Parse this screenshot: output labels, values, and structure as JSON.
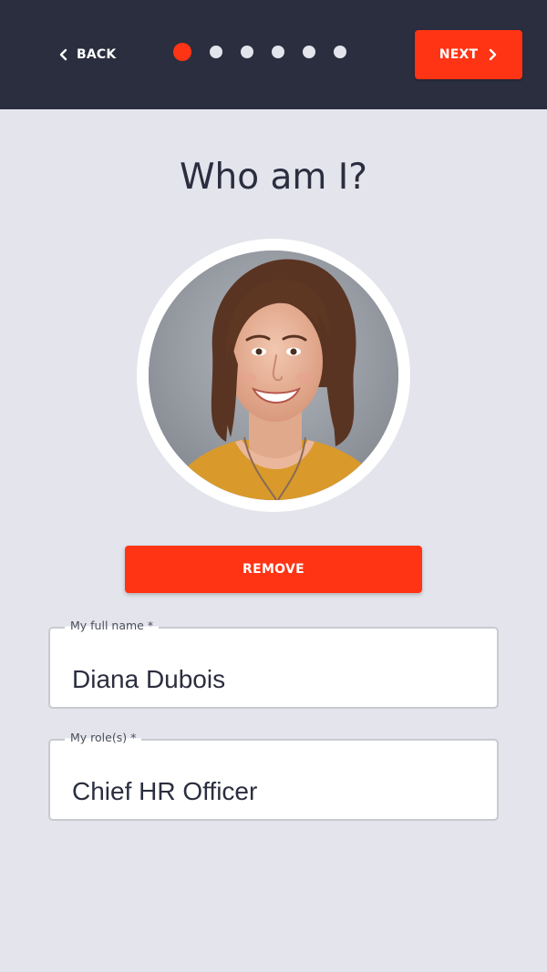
{
  "header": {
    "back_label": "BACK",
    "next_label": "NEXT",
    "steps": {
      "total": 6,
      "current": 1
    }
  },
  "page": {
    "title": "Who am I?"
  },
  "avatar": {
    "icon": "profile-photo"
  },
  "actions": {
    "remove_label": "REMOVE"
  },
  "form": {
    "full_name": {
      "label": "My full name *",
      "value": "Diana Dubois"
    },
    "roles": {
      "label": "My role(s) *",
      "value": "Chief HR Officer"
    }
  },
  "colors": {
    "header_bg": "#2b2e3f",
    "accent": "#ff3414",
    "page_bg": "#e3e4ec",
    "text_dark": "#2b2e3f"
  }
}
